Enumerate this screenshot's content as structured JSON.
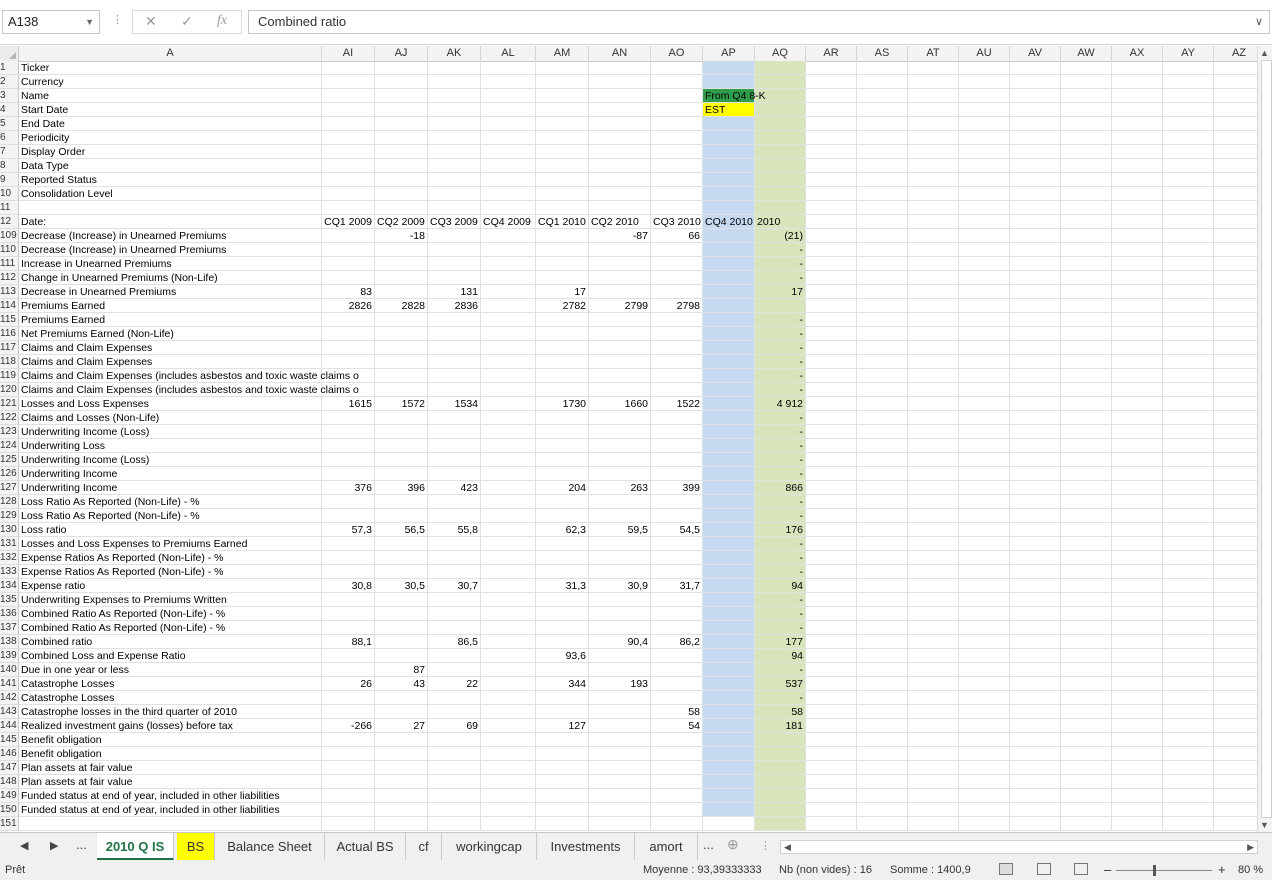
{
  "formula_bar": {
    "name_box": "A138",
    "formula": "Combined ratio"
  },
  "columns": [
    "A",
    "AI",
    "AJ",
    "AK",
    "AL",
    "AM",
    "AN",
    "AO",
    "AP",
    "AQ",
    "AR",
    "AS",
    "AT",
    "AU",
    "AV",
    "AW",
    "AX",
    "AY",
    "AZ"
  ],
  "rows": [
    {
      "num": "1",
      "A": "Ticker"
    },
    {
      "num": "2",
      "A": "Currency"
    },
    {
      "num": "3",
      "A": "Name",
      "AP": "From Q4 8-K"
    },
    {
      "num": "4",
      "A": "Start Date",
      "AP": "EST"
    },
    {
      "num": "5",
      "A": "End Date"
    },
    {
      "num": "6",
      "A": "Periodicity"
    },
    {
      "num": "7",
      "A": "Display Order"
    },
    {
      "num": "8",
      "A": "Data Type"
    },
    {
      "num": "9",
      "A": "Reported Status"
    },
    {
      "num": "10",
      "A": "Consolidation Level"
    },
    {
      "num": "11"
    },
    {
      "num": "12",
      "A": "Date:",
      "AI": "CQ1 2009",
      "AJ": "CQ2 2009",
      "AK": "CQ3 2009",
      "AL": "CQ4 2009",
      "AM": "CQ1 2010",
      "AN": "CQ2 2010",
      "AO": "CQ3 2010",
      "AP": "CQ4 2010",
      "AQ": "2010"
    },
    {
      "num": "109",
      "A": "Decrease (Increase) in Unearned Premiums",
      "AJ": "-18",
      "AN": "-87",
      "AO": "66",
      "AQ": "(21)"
    },
    {
      "num": "110",
      "A": "Decrease (Increase) in Unearned Premiums",
      "AQ": "-"
    },
    {
      "num": "111",
      "A": "Increase in Unearned Premiums",
      "AQ": "-"
    },
    {
      "num": "112",
      "A": "Change in Unearned Premiums (Non-Life)",
      "AQ": "-"
    },
    {
      "num": "113",
      "A": "Decrease in Unearned Premiums",
      "AI": "83",
      "AK": "131",
      "AM": "17",
      "AQ": "17"
    },
    {
      "num": "114",
      "A": "Premiums Earned",
      "AI": "2826",
      "AJ": "2828",
      "AK": "2836",
      "AM": "2782",
      "AN": "2799",
      "AO": "2798"
    },
    {
      "num": "115",
      "A": "Premiums Earned",
      "AQ": "-"
    },
    {
      "num": "116",
      "A": "Net Premiums Earned (Non-Life)",
      "AQ": "-"
    },
    {
      "num": "117",
      "A": "Claims and Claim Expenses",
      "AQ": "-"
    },
    {
      "num": "118",
      "A": "Claims and Claim Expenses",
      "AQ": "-"
    },
    {
      "num": "119",
      "A": "Claims and Claim Expenses (includes asbestos and toxic waste claims o",
      "AQ": "-"
    },
    {
      "num": "120",
      "A": "Claims and Claim Expenses (includes asbestos and toxic waste claims o",
      "AQ": "-"
    },
    {
      "num": "121",
      "A": "Losses and Loss Expenses",
      "AI": "1615",
      "AJ": "1572",
      "AK": "1534",
      "AM": "1730",
      "AN": "1660",
      "AO": "1522",
      "AQ": "4 912"
    },
    {
      "num": "122",
      "A": "Claims and Losses (Non-Life)",
      "AQ": "-"
    },
    {
      "num": "123",
      "A": "Underwriting Income (Loss)",
      "AQ": "-"
    },
    {
      "num": "124",
      "A": "Underwriting Loss",
      "AQ": "-"
    },
    {
      "num": "125",
      "A": "Underwriting Income (Loss)",
      "AQ": "-"
    },
    {
      "num": "126",
      "A": "Underwriting Income",
      "AQ": "-"
    },
    {
      "num": "127",
      "A": "Underwriting Income",
      "AI": "376",
      "AJ": "396",
      "AK": "423",
      "AM": "204",
      "AN": "263",
      "AO": "399",
      "AQ": "866"
    },
    {
      "num": "128",
      "A": "Loss Ratio As Reported (Non-Life) - %",
      "AQ": "-"
    },
    {
      "num": "129",
      "A": "Loss Ratio As Reported (Non-Life) - %",
      "AQ": "-"
    },
    {
      "num": "130",
      "A": "Loss ratio",
      "AI": "57,3",
      "AJ": "56,5",
      "AK": "55,8",
      "AM": "62,3",
      "AN": "59,5",
      "AO": "54,5",
      "AQ": "176"
    },
    {
      "num": "131",
      "A": "Losses and Loss Expenses to  Premiums Earned",
      "AQ": "-"
    },
    {
      "num": "132",
      "A": "Expense Ratios As Reported (Non-Life) - %",
      "AQ": "-"
    },
    {
      "num": "133",
      "A": "Expense Ratios As Reported (Non-Life) - %",
      "AQ": "-"
    },
    {
      "num": "134",
      "A": "Expense ratio",
      "AI": "30,8",
      "AJ": "30,5",
      "AK": "30,7",
      "AM": "31,3",
      "AN": "30,9",
      "AO": "31,7",
      "AQ": "94"
    },
    {
      "num": "135",
      "A": "Underwriting Expenses to  Premiums Written",
      "AQ": "-"
    },
    {
      "num": "136",
      "A": "Combined Ratio As Reported (Non-Life) - %",
      "AQ": "-"
    },
    {
      "num": "137",
      "A": "Combined Ratio As Reported (Non-Life) - %",
      "AQ": "-"
    },
    {
      "num": "138",
      "A": "Combined ratio",
      "AI": "88,1",
      "AK": "86,5",
      "AN": "90,4",
      "AO": "86,2",
      "AQ": "177"
    },
    {
      "num": "139",
      "A": "Combined Loss and Expense Ratio",
      "AM": "93,6",
      "AQ": "94"
    },
    {
      "num": "140",
      "A": "Due in one year or less",
      "AJ": "87",
      "AQ": "-"
    },
    {
      "num": "141",
      "A": "Catastrophe Losses",
      "AI": "26",
      "AJ": "43",
      "AK": "22",
      "AM": "344",
      "AN": "193",
      "AQ": "537"
    },
    {
      "num": "142",
      "A": "Catastrophe Losses",
      "AQ": "-"
    },
    {
      "num": "143",
      "A": "Catastrophe losses in the third quarter of 2010",
      "AO": "58",
      "AQ": "58"
    },
    {
      "num": "144",
      "A": "Realized investment gains (losses) before tax",
      "AI": "-266",
      "AJ": "27",
      "AK": "69",
      "AM": "127",
      "AO": "54",
      "AQ": "181"
    },
    {
      "num": "145",
      "A": "Benefit obligation"
    },
    {
      "num": "146",
      "A": "Benefit obligation"
    },
    {
      "num": "147",
      "A": "Plan assets at fair value"
    },
    {
      "num": "148",
      "A": "Plan assets at fair value"
    },
    {
      "num": "149",
      "A": "Funded status at end of year, included in other liabilities"
    },
    {
      "num": "150",
      "A": "Funded status at end of year, included in other liabilities"
    },
    {
      "num": "151"
    }
  ],
  "sheet_tabs": {
    "more": "...",
    "tabs": [
      "2010 Q IS",
      "BS",
      "Balance Sheet",
      "Actual BS",
      "cf",
      "workingcap",
      "Investments",
      "amort"
    ],
    "active": "2010 Q IS",
    "more_right": "..."
  },
  "status_bar": {
    "ready": "Prêt",
    "average": "Moyenne : 93,39333333",
    "count": "Nb (non vides) : 16",
    "sum": "Somme : 1400,9",
    "zoom": "80 %"
  },
  "colors": {
    "ap_fill": "#c5d9f1",
    "aq_fill": "#d8e4bc",
    "green_fill": "#2e9e4c",
    "yellow_fill": "#ffff00",
    "excel_green": "#217346"
  }
}
